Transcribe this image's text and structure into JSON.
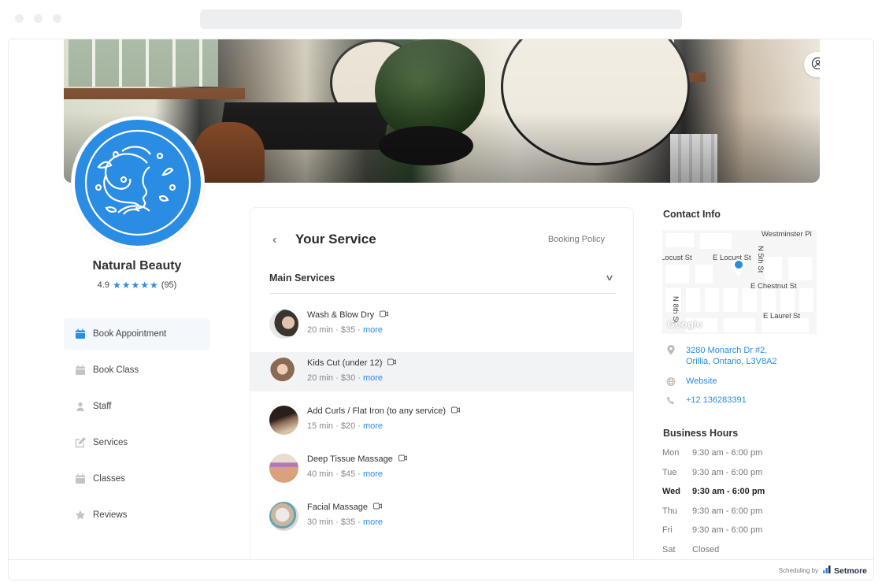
{
  "browser": {
    "url": ""
  },
  "header": {
    "login_label": "Login"
  },
  "business": {
    "name": "Natural Beauty",
    "rating": "4.9",
    "stars": 4.9,
    "review_count": "(95)",
    "brand_color": "#2a8ce3"
  },
  "sidebar": {
    "items": [
      {
        "label": "Book Appointment",
        "icon": "calendar-icon",
        "active": true
      },
      {
        "label": "Book Class",
        "icon": "calendar-icon",
        "active": false
      },
      {
        "label": "Staff",
        "icon": "person-icon",
        "active": false
      },
      {
        "label": "Services",
        "icon": "edit-icon",
        "active": false
      },
      {
        "label": "Classes",
        "icon": "calendar-icon",
        "active": false
      },
      {
        "label": "Reviews",
        "icon": "star-icon",
        "active": false
      }
    ]
  },
  "main": {
    "title": "Your Service",
    "booking_policy": "Booking Policy",
    "category": "Main Services",
    "separator": "·",
    "more_label": "more",
    "services": [
      {
        "name": "Wash & Blow Dry",
        "duration": "20 min",
        "price": "$35",
        "video": true
      },
      {
        "name": "Kids Cut (under 12)",
        "duration": "20 min",
        "price": "$30",
        "video": true,
        "highlighted": true
      },
      {
        "name": "Add Curls / Flat Iron (to any service)",
        "duration": "15 min",
        "price": "$20",
        "video": true
      },
      {
        "name": "Deep Tissue Massage",
        "duration": "40 min",
        "price": "$45",
        "video": true
      },
      {
        "name": "Facial Massage",
        "duration": "30 min",
        "price": "$35",
        "video": true
      }
    ]
  },
  "contact": {
    "title": "Contact Info",
    "map_labels": {
      "westminster": "Westminster Pl",
      "locust_w": "Locust St",
      "locust_e": "E Locust St",
      "n5th": "N 5th St",
      "chestnut": "E Chestnut St",
      "n8th": "N 8th St",
      "laurel": "E Laurel St",
      "google": "Google"
    },
    "address_line1": "3280 Monarch Dr #2,",
    "address_line2": "Orillia, Ontario, L3V8A2",
    "website": "Website",
    "phone": "+12 136283391"
  },
  "hours": {
    "title": "Business Hours",
    "days": [
      {
        "day": "Mon",
        "time": "9:30 am - 6:00 pm"
      },
      {
        "day": "Tue",
        "time": "9:30 am - 6:00 pm"
      },
      {
        "day": "Wed",
        "time": "9:30 am - 6:00 pm",
        "today": true
      },
      {
        "day": "Thu",
        "time": "9:30 am - 6:00 pm"
      },
      {
        "day": "Fri",
        "time": "9:30 am - 6:00 pm"
      },
      {
        "day": "Sat",
        "time": "Closed"
      }
    ]
  },
  "footer": {
    "scheduling_by": "Scheduling by",
    "brand": "Setmore"
  }
}
